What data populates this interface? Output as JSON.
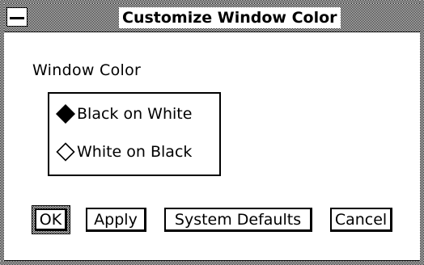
{
  "window": {
    "title": "Customize Window Color"
  },
  "section": {
    "label": "Window Color"
  },
  "options": [
    {
      "label": "Black on White",
      "selected": true
    },
    {
      "label": "White on Black",
      "selected": false
    }
  ],
  "buttons": {
    "ok": "OK",
    "apply": "Apply",
    "system_defaults": "System Defaults",
    "cancel": "Cancel"
  },
  "icons": {
    "window_menu": "window-menu-icon",
    "selected_radio": "filled-diamond-icon",
    "unselected_radio": "hollow-diamond-icon"
  }
}
